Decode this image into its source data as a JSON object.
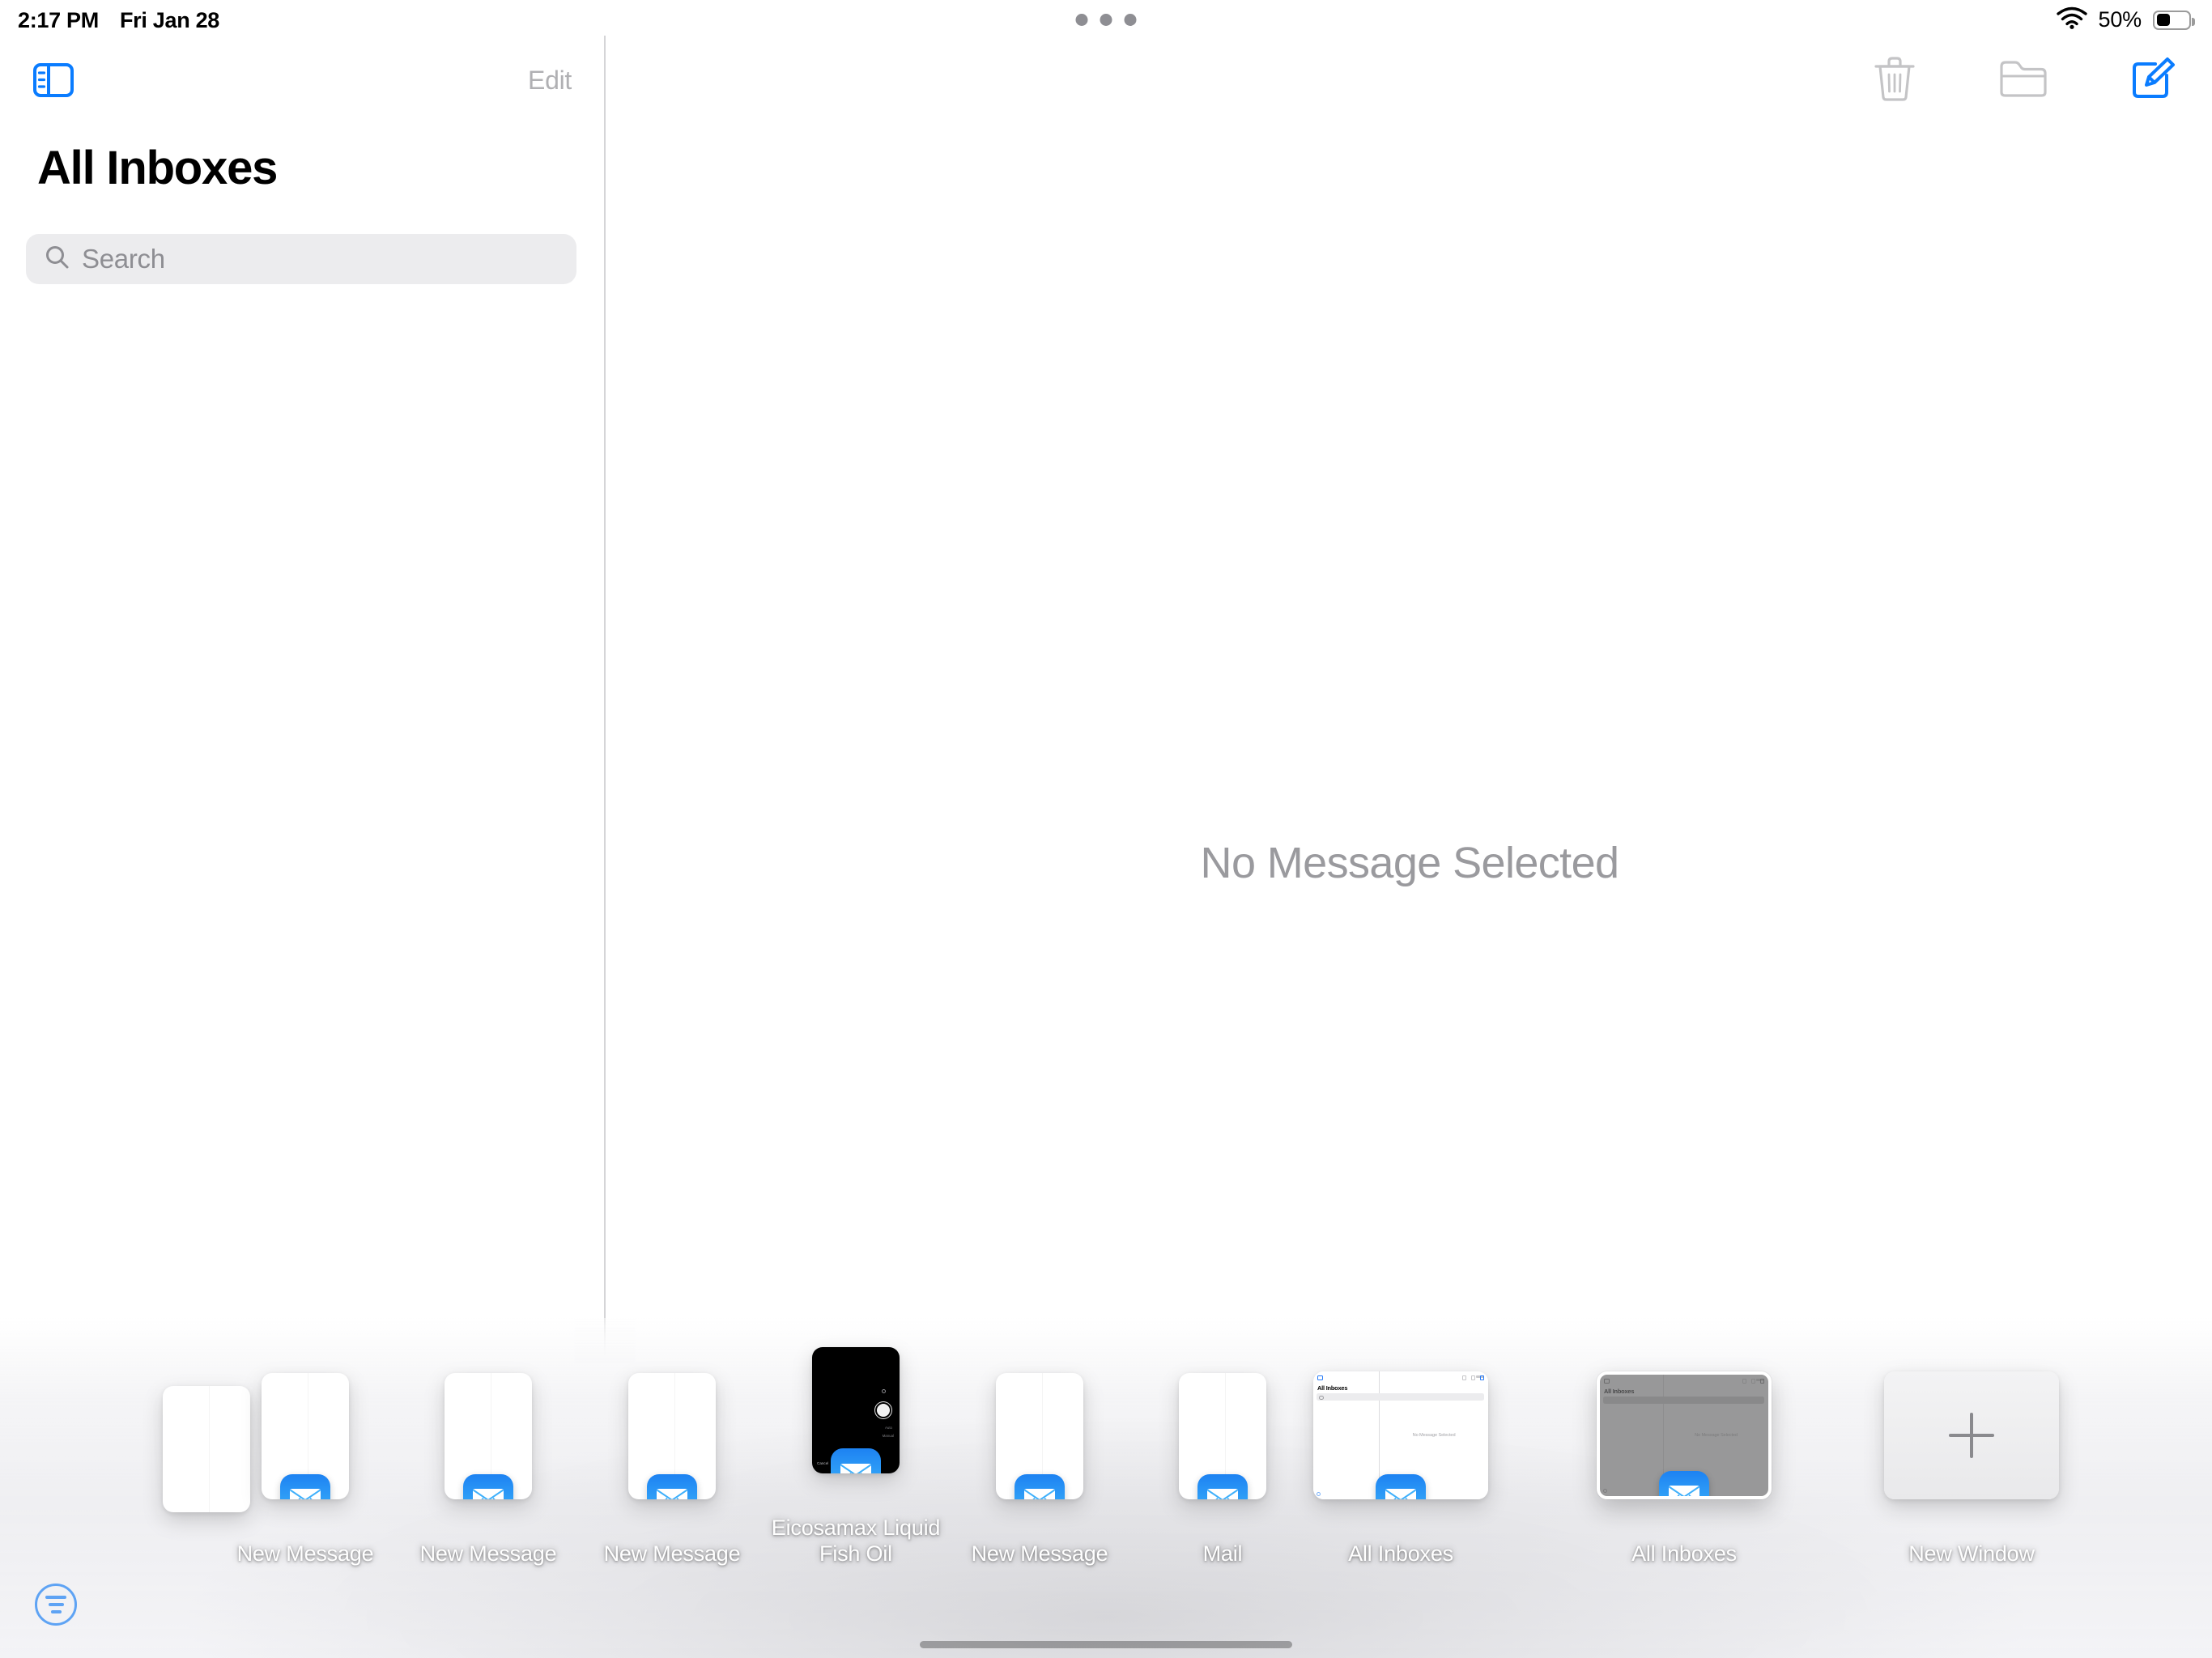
{
  "status_bar": {
    "time": "2:17 PM",
    "date": "Fri Jan 28",
    "battery_percent": "50%",
    "battery_level": 50,
    "wifi_icon": "wifi-icon",
    "battery_icon": "battery-icon"
  },
  "multitask": {
    "dots_icon": "multitask-dots-icon",
    "dot_count": 3
  },
  "sidebar": {
    "toggle_icon": "sidebar-toggle-icon",
    "edit_label": "Edit",
    "title": "All Inboxes",
    "search": {
      "placeholder": "Search",
      "icon": "search-icon",
      "value": ""
    }
  },
  "detail": {
    "empty_state": "No Message Selected",
    "toolbar": [
      {
        "name": "trash-icon",
        "label": "Trash",
        "enabled": false
      },
      {
        "name": "folder-icon",
        "label": "Move to Folder",
        "enabled": false
      },
      {
        "name": "compose-icon",
        "label": "Compose",
        "enabled": true
      }
    ]
  },
  "colors": {
    "accent_blue": "#0a7cff",
    "disabled_gray": "#c4c4c6",
    "placeholder_gray": "#8e8e93",
    "empty_text_gray": "#9a9a9e",
    "search_bg": "#ececee",
    "mail_icon_top": "#1d82f2",
    "mail_icon_bottom": "#35b4fb"
  },
  "expose": {
    "app_library_icon": "app-library-icon",
    "home_indicator": "home-indicator",
    "windows": [
      {
        "label": "",
        "kind": "blank",
        "orientation": "portrait",
        "selected": false,
        "partial": true,
        "has_badge": false
      },
      {
        "label": "New Message",
        "kind": "blank",
        "orientation": "portrait",
        "selected": false,
        "partial": false,
        "has_badge": true
      },
      {
        "label": "New Message",
        "kind": "blank",
        "orientation": "portrait",
        "selected": false,
        "partial": false,
        "has_badge": true
      },
      {
        "label": "New Message",
        "kind": "blank",
        "orientation": "portrait",
        "selected": false,
        "partial": false,
        "has_badge": true
      },
      {
        "label": "Eicosamax Liquid Fish Oil",
        "kind": "camera",
        "orientation": "portrait",
        "selected": false,
        "partial": false,
        "has_badge": true
      },
      {
        "label": "New Message",
        "kind": "blank",
        "orientation": "portrait",
        "selected": false,
        "partial": false,
        "has_badge": true
      },
      {
        "label": "Mail",
        "kind": "blank",
        "orientation": "portrait",
        "selected": false,
        "partial": false,
        "has_badge": true
      },
      {
        "label": "All Inboxes",
        "kind": "mail-ui",
        "orientation": "landscape",
        "selected": false,
        "partial": false,
        "has_badge": true
      },
      {
        "label": "All Inboxes",
        "kind": "mail-ui",
        "orientation": "landscape",
        "selected": true,
        "partial": false,
        "has_badge": true
      },
      {
        "label": "New Window",
        "kind": "new-window",
        "orientation": "landscape",
        "selected": false,
        "partial": false,
        "has_badge": false
      }
    ],
    "thumbnail_ui": {
      "title": "All Inboxes",
      "empty_state": "No Message Selected",
      "edit_label": "Edit"
    },
    "camera_thumb": {
      "cancel_label": "Cancel",
      "mode_labels": [
        "Auto",
        "Manual"
      ]
    }
  }
}
